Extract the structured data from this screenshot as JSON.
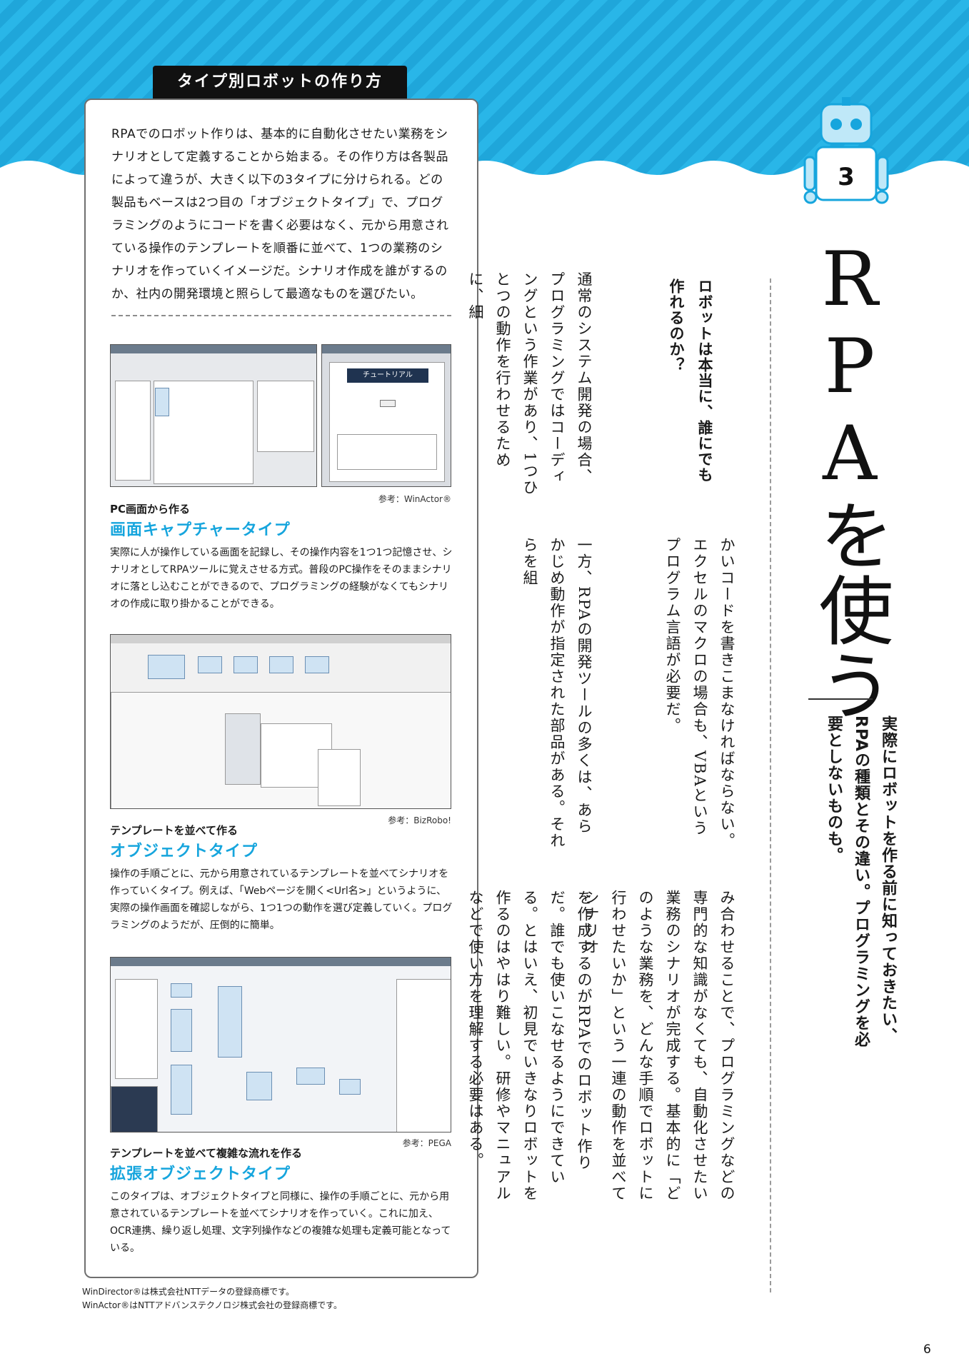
{
  "box": {
    "title": "タイプ別ロボットの作り方",
    "intro": "RPAでのロボット作りは、基本的に自動化させたい業務をシナリオとして定義することから始まる。その作り方は各製品によって違うが、大きく以下の3タイプに分けられる。どの製品もベースは2つ目の「オブジェクトタイプ」で、プログラミングのようにコードを書く必要はなく、元から用意されている操作のテンプレートを順番に並べて、1つの業務のシナリオを作っていくイメージだ。シナリオ作成を誰がするのか、社内の開発環境と照らして最適なものを選びたい。",
    "types": [
      {
        "credit": "参考：WinActor®",
        "subhead": "PC画面から作る",
        "name": "画面キャプチャータイプ",
        "desc": "実際に人が操作している画面を記録し、その操作内容を1つ1つ記憶させ、シナリオとしてRPAツールに覚えさせる方式。普段のPC操作をそのままシナリオに落とし込むことができるので、プログラミングの経験がなくてもシナリオの作成に取り掛かることができる。"
      },
      {
        "credit": "参考：BizRobo!",
        "subhead": "テンプレートを並べて作る",
        "name": "オブジェクトタイプ",
        "desc": "操作の手順ごとに、元から用意されているテンプレートを並べてシナリオを作っていくタイプ。例えば、「Webページを開く<Url名>」というように、実際の操作画面を確認しながら、1つ1つの動作を選び定義していく。プログラミングのようだが、圧倒的に簡単。"
      },
      {
        "credit": "参考：PEGA",
        "subhead": "テンプレートを並べて複雑な流れを作る",
        "name": "拡張オブジェクトタイプ",
        "desc": "このタイプは、オブジェクトタイプと同様に、操作の手順ごとに、元から用意されているテンプレートを並べてシナリオを作っていく。これに加え、OCR連携、繰り返し処理、文字列操作などの複雑な処理も定義可能となっている。"
      }
    ],
    "screenshot_label": "チュートリアル"
  },
  "notes": [
    "WinDirector®は株式会社NTTデータの登録商標です。",
    "WinActor®はNTTアドバンステクノロジ株式会社の登録商標です。"
  ],
  "chapter": {
    "number": "3",
    "title": "RPAを使う"
  },
  "lead": "実際にロボットを作る前に知っておきたい、RPAの種類とその違い。プログラミングを必要としないものも。",
  "article": {
    "heading": "ロボットは本当に、誰にでも作れるのか？",
    "col1": "通常のシステム開発の場合、プログラミングではコーディングという作業があり、1つひとつの動作を行わせるために、細",
    "col2": "かいコードを書きこまなければならない。エクセルのマクロの場合も、VBAというプログラム言語が必要だ。",
    "col3": "一方、RPAの開発ツールの多くは、あらかじめ動作が指定された部品がある。それらを組",
    "col4": "み合わせることで、プログラミングなどの専門的な知識がなくても、自動化させたい業務のシナリオが完成する。基本的に「どのような業務を、どんな手順でロボットに行わせたいか」という一連の動作を並べてシナリオ",
    "col5": "を作成するのがRPAでのロボット作りだ。誰でも使いこなせるようにできている。とはいえ、初見でいきなりロボットを作るのはやはり難しい。研修やマニュアルなどで使い方を理解する必要はある。"
  },
  "page_number": "6",
  "colors": {
    "accent": "#16a5dd",
    "sky": "#29b6e8"
  }
}
